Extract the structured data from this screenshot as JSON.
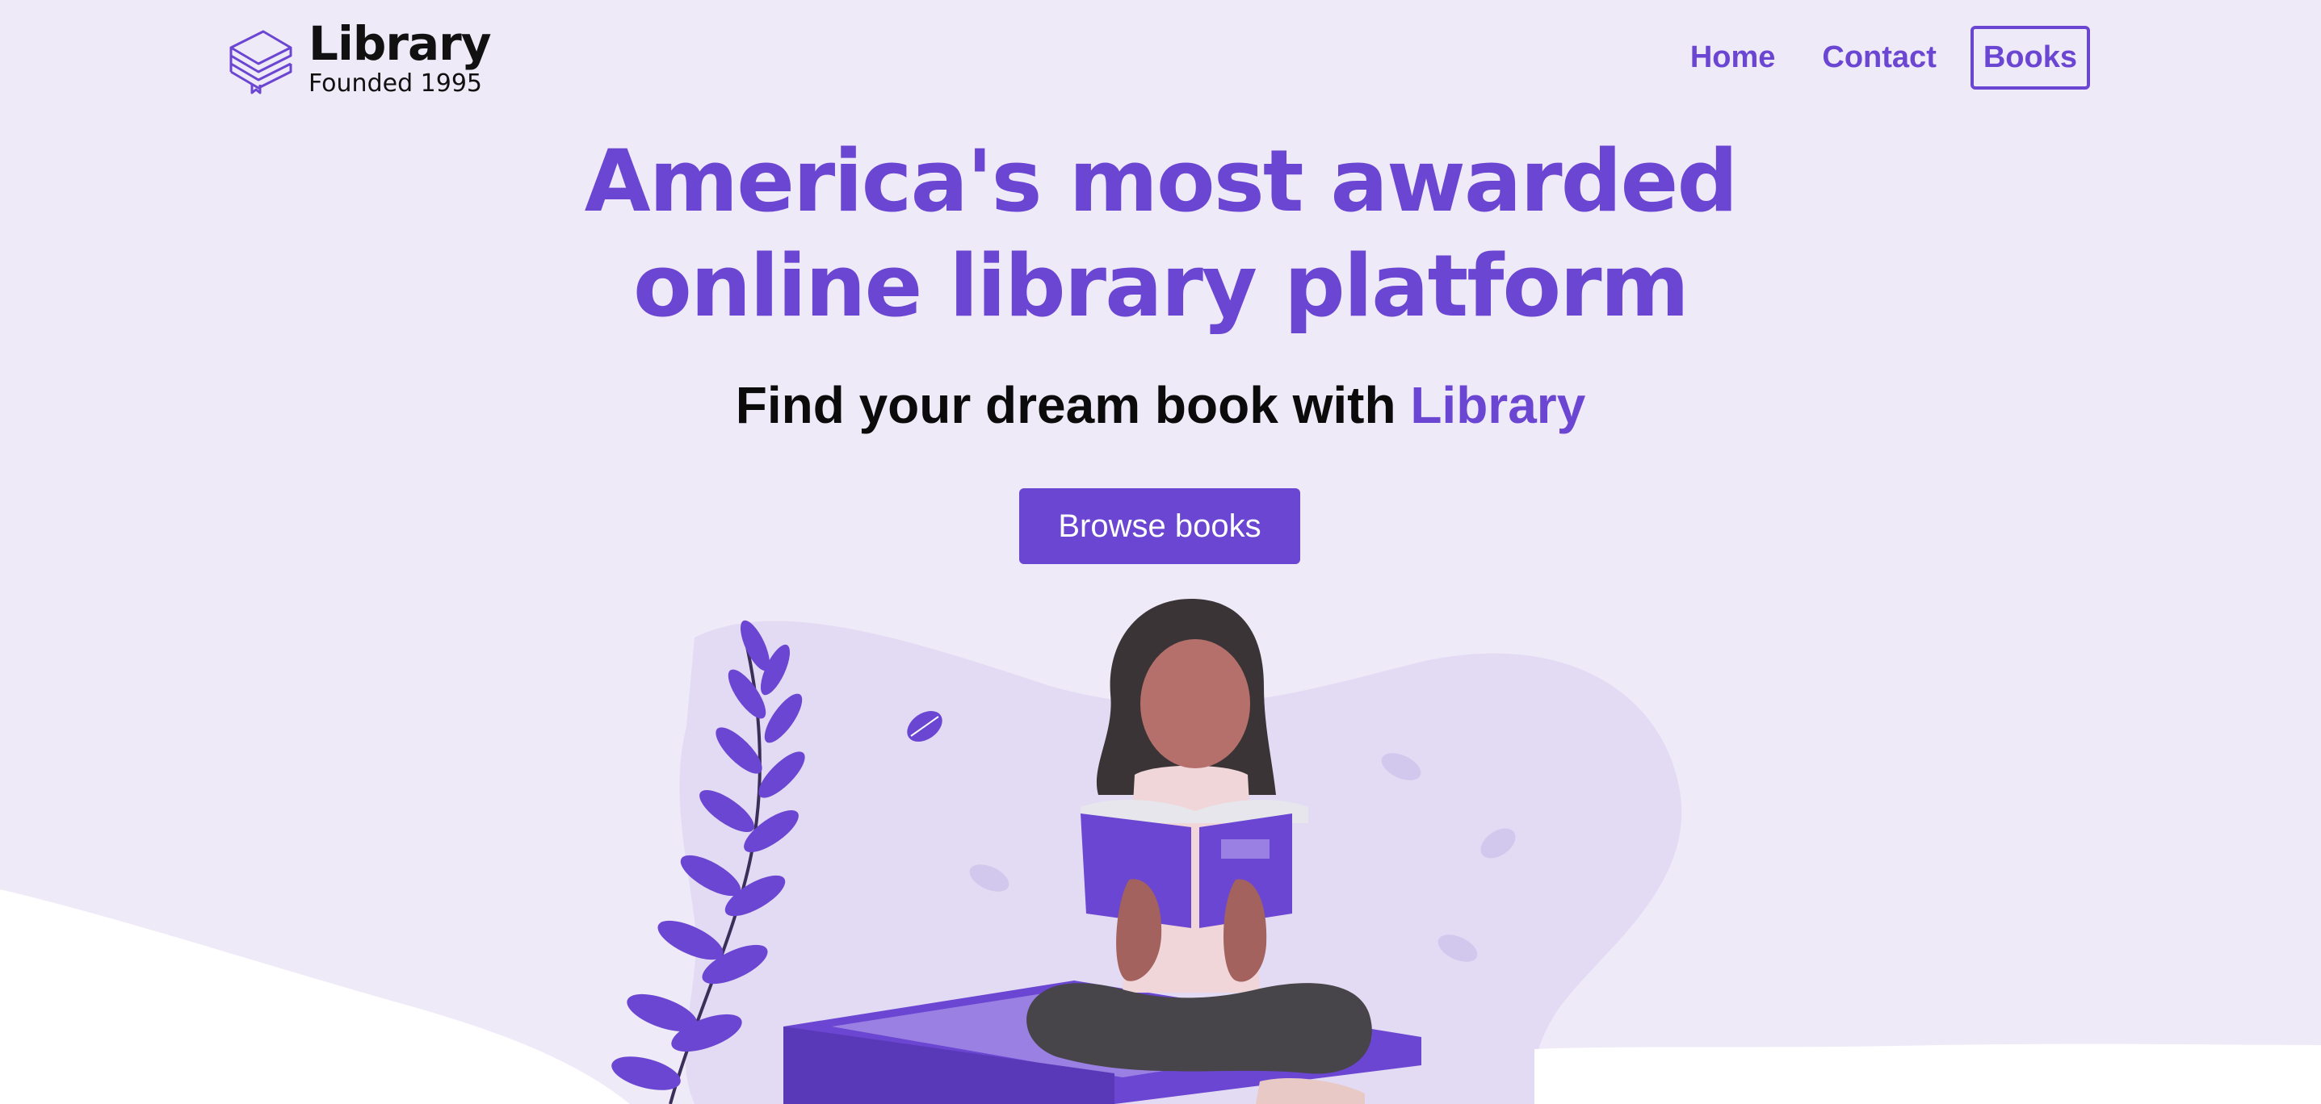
{
  "header": {
    "logo_title": "Library",
    "logo_subtitle": "Founded 1995",
    "logo_icon": "stacked-books-icon"
  },
  "nav": {
    "items": [
      {
        "label": "Home",
        "active": false
      },
      {
        "label": "Contact",
        "active": false
      },
      {
        "label": "Books",
        "active": true
      }
    ]
  },
  "hero": {
    "headline_line1": "America's most awarded",
    "headline_line2": "online library platform",
    "tagline_prefix": "Find your dream book with ",
    "tagline_accent": "Library",
    "cta_label": "Browse books"
  },
  "colors": {
    "accent": "#6b46d2",
    "background": "#efeaf8",
    "blob": "#e3dbf4",
    "text_dark": "#0b0b0b"
  },
  "illustration": {
    "subject": "woman-reading-book-illustration"
  }
}
